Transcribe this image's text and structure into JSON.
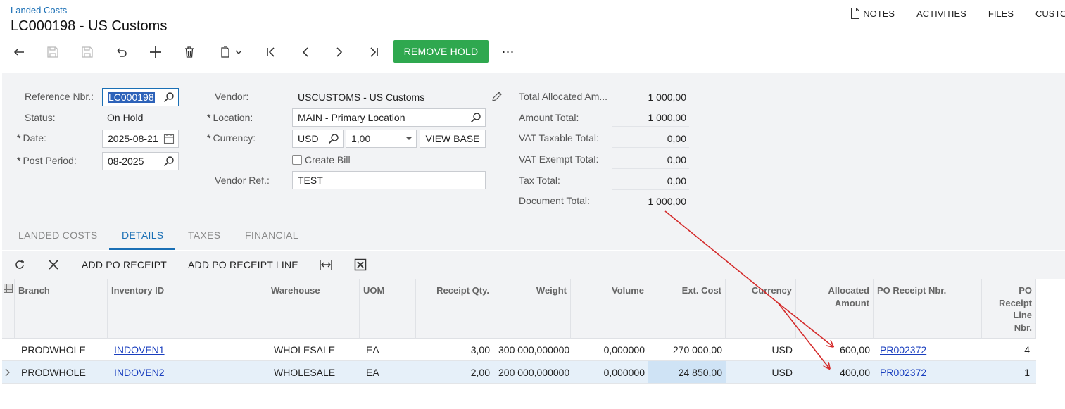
{
  "header": {
    "breadcrumb": "Landed Costs",
    "title": "LC000198 - US Customs",
    "links": {
      "notes": "NOTES",
      "activities": "ACTIVITIES",
      "files": "FILES",
      "customization": "CUSTO"
    }
  },
  "toolbar": {
    "icons": [
      "back-icon",
      "save-close-icon",
      "save-icon",
      "undo-icon",
      "add-icon",
      "delete-icon",
      "copy-paste-icon",
      "first-icon",
      "previous-icon",
      "next-icon",
      "last-icon",
      "more-icon"
    ],
    "remove_hold": "REMOVE HOLD",
    "more": "⋯"
  },
  "form": {
    "reference_nbr": {
      "label": "Reference Nbr.:",
      "value": "LC000198"
    },
    "status": {
      "label": "Status:",
      "value": "On Hold"
    },
    "date": {
      "label": "Date:",
      "value": "2025-08-21"
    },
    "post_period": {
      "label": "Post Period:",
      "value": "08-2025"
    },
    "vendor": {
      "label": "Vendor:",
      "value": "USCUSTOMS - US Customs"
    },
    "location": {
      "label": "Location:",
      "value": "MAIN - Primary Location"
    },
    "currency": {
      "label": "Currency:",
      "code": "USD",
      "rate": "1,00",
      "view_base": "VIEW BASE"
    },
    "create_bill": {
      "label": "Create Bill",
      "checked": false
    },
    "vendor_ref": {
      "label": "Vendor Ref.:",
      "value": "TEST"
    },
    "required_mark": "*"
  },
  "summary": [
    {
      "label": "Total Allocated Am...",
      "value": "1 000,00"
    },
    {
      "label": "Amount Total:",
      "value": "1 000,00"
    },
    {
      "label": "VAT Taxable Total:",
      "value": "0,00"
    },
    {
      "label": "VAT Exempt Total:",
      "value": "0,00"
    },
    {
      "label": "Tax Total:",
      "value": "0,00"
    },
    {
      "label": "Document Total:",
      "value": "1 000,00"
    }
  ],
  "tabs": [
    "LANDED COSTS",
    "DETAILS",
    "TAXES",
    "FINANCIAL"
  ],
  "active_tab": "DETAILS",
  "grid_toolbar": {
    "add_po_receipt": "ADD PO RECEIPT",
    "add_po_receipt_line": "ADD PO RECEIPT LINE"
  },
  "grid": {
    "columns": [
      "Branch",
      "Inventory ID",
      "Warehouse",
      "UOM",
      "Receipt Qty.",
      "Weight",
      "Volume",
      "Ext. Cost",
      "Currency",
      "Allocated Amount",
      "PO Receipt Nbr.",
      "PO Receipt Line Nbr."
    ],
    "rows": [
      [
        "PRODWHOLE",
        "INDOVEN1",
        "WHOLESALE",
        "EA",
        "3,00",
        "300 000,000000",
        "0,000000",
        "270 000,00",
        "USD",
        "600,00",
        "PR002372",
        "4"
      ],
      [
        "PRODWHOLE",
        "INDOVEN2",
        "WHOLESALE",
        "EA",
        "2,00",
        "200 000,000000",
        "0,000000",
        "24 850,00",
        "USD",
        "400,00",
        "PR002372",
        "1"
      ]
    ],
    "selected_row": 1
  },
  "colors": {
    "accent": "#1a6fb5",
    "primary_button": "#2fa84f",
    "annotation": "#d42b2b"
  }
}
